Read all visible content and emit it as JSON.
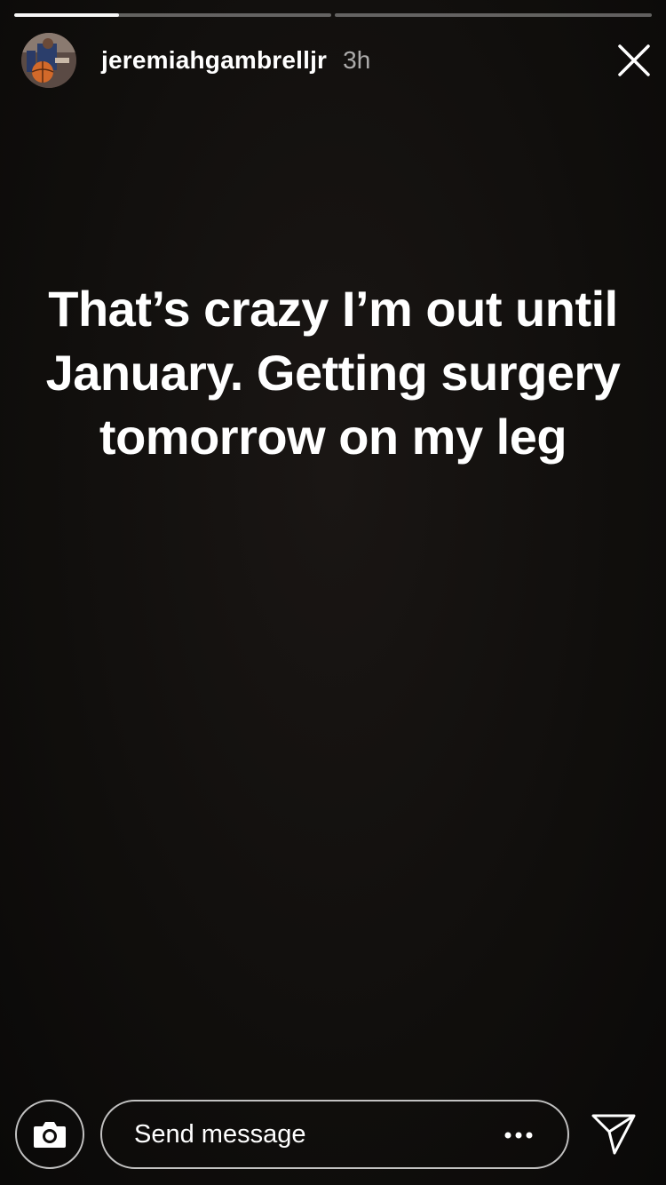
{
  "story": {
    "progress": {
      "segments": [
        0.33,
        0.0
      ]
    },
    "author": {
      "username": "jeremiahgambrelljr",
      "posted_ago": "3h",
      "avatar_icon": "basketball-player-avatar"
    },
    "text": "That’s crazy I’m out until January. Getting surgery tomorrow on my leg",
    "close_icon": "close-icon"
  },
  "composer": {
    "camera_icon": "camera-icon",
    "placeholder": "Send message",
    "more_icon": "more-dots-icon",
    "send_icon": "send-icon"
  },
  "colors": {
    "background": "#0d0b0a",
    "text": "#ffffff",
    "muted_text": "#a6a6a6"
  }
}
